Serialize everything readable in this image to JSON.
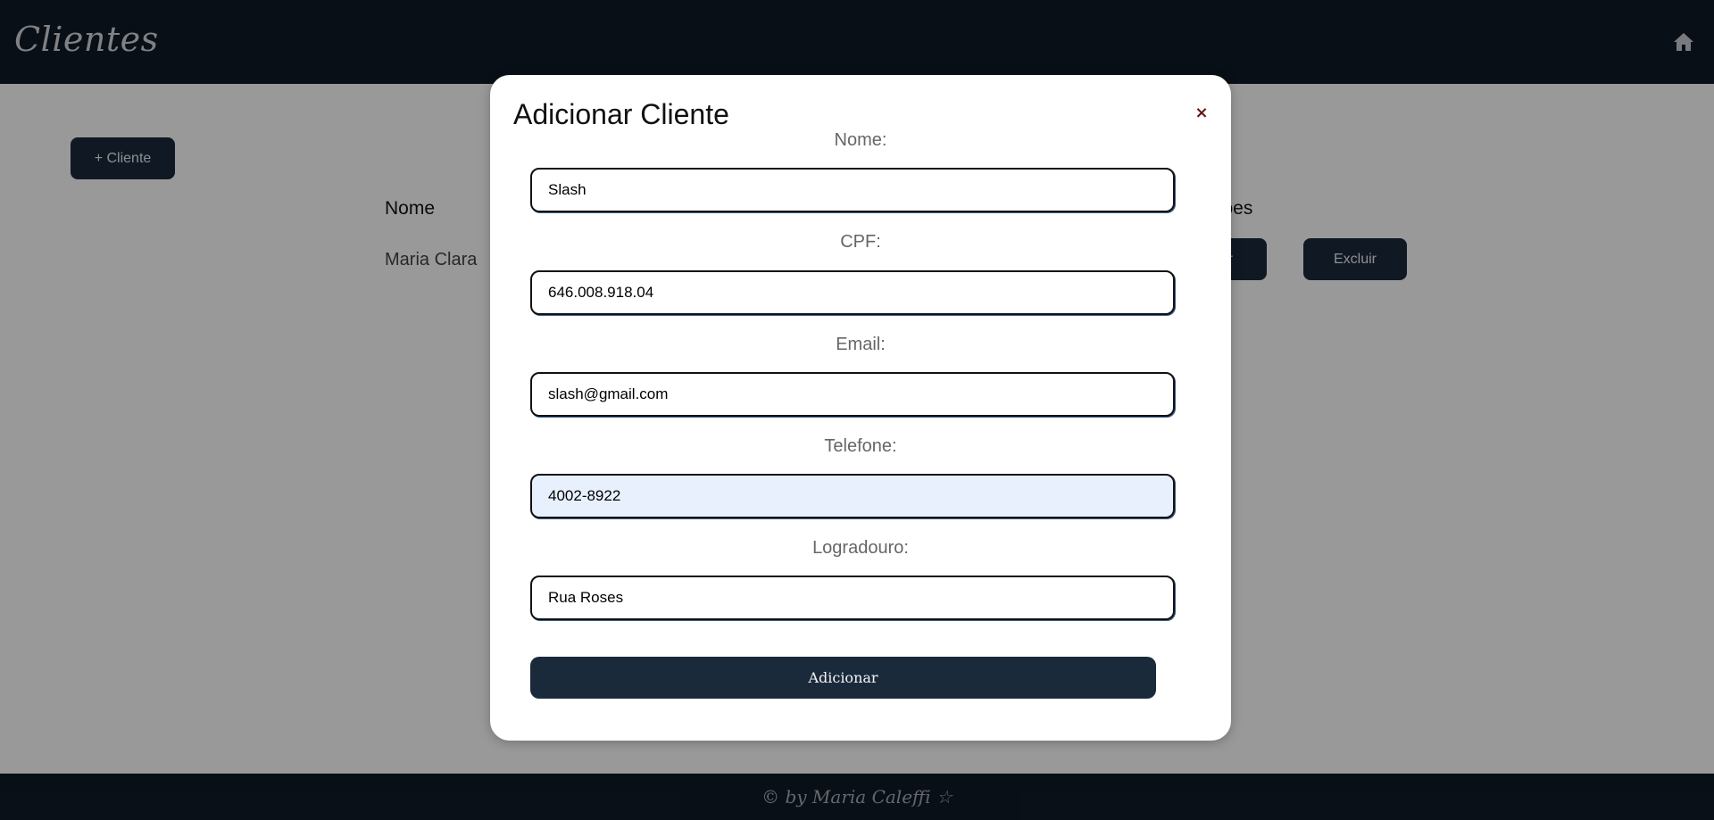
{
  "header": {
    "title": "Clientes",
    "home_icon": "home-icon"
  },
  "page": {
    "add_client_label": "+ Cliente",
    "table": {
      "columns": [
        "Nome",
        "Ações"
      ],
      "rows": [
        {
          "name": "Maria Clara",
          "edit_label": "Editar",
          "delete_label": "Excluir"
        }
      ]
    }
  },
  "modal": {
    "title": "Adicionar Cliente",
    "close_label": "×",
    "fields": [
      {
        "label": "Nome:",
        "value": "Slash"
      },
      {
        "label": "CPF:",
        "value": "646.008.918.04"
      },
      {
        "label": "Email:",
        "value": "slash@gmail.com"
      },
      {
        "label": "Telefone:",
        "value": "4002-8922"
      },
      {
        "label": "Logradouro:",
        "value": "Rua Roses"
      }
    ],
    "submit_label": "Adicionar"
  },
  "footer": {
    "text": "© by Maria Caleffi ☆"
  },
  "colors": {
    "header_bg": "#101a26",
    "button_bg": "#1b2a3b",
    "autofill_bg": "#e8f0fe",
    "close_color": "#6b1010"
  }
}
